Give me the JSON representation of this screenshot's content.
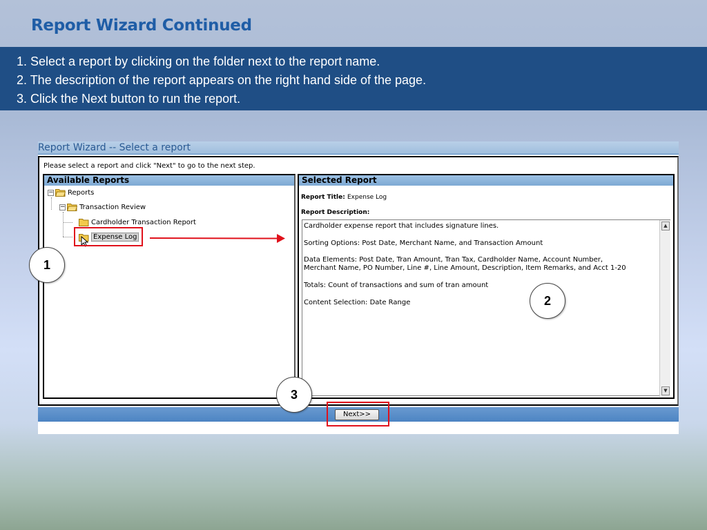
{
  "slide": {
    "title": "Report Wizard Continued",
    "steps": [
      "1. Select a report by clicking on the folder next to the report name.",
      "2. The description of the report appears on the right hand side of the page.",
      "3. Click the Next button to run the report."
    ]
  },
  "wizard": {
    "window_title": "Report Wizard -- Select a report",
    "instruction": "Please select a report and click \"Next\" to go to the next step.",
    "available": {
      "header": "Available Reports",
      "tree": {
        "root": "Reports",
        "group": "Transaction Review",
        "items": [
          "Cardholder Transaction Report",
          "Expense Log"
        ]
      }
    },
    "selected": {
      "header": "Selected Report",
      "title_label": "Report Title:",
      "title_value": "Expense Log",
      "description_label": "Report Description:",
      "description": "Cardholder expense report that includes signature lines.\n\nSorting Options: Post Date, Merchant Name, and Transaction Amount\n\nData Elements: Post Date, Tran Amount, Tran Tax, Cardholder Name, Account Number,\nMerchant Name, PO Number, Line #, Line Amount, Description, Item Remarks, and Acct 1-20\n\nTotals: Count of transactions and sum of tran amount\n\nContent Selection: Date Range"
    },
    "next_label": "Next>>"
  },
  "callouts": [
    "1",
    "2",
    "3"
  ],
  "colors": {
    "accent_title": "#1f5da6",
    "band": "#1f4e85",
    "highlight": "#e0111b",
    "folder": "#f2c94c"
  }
}
